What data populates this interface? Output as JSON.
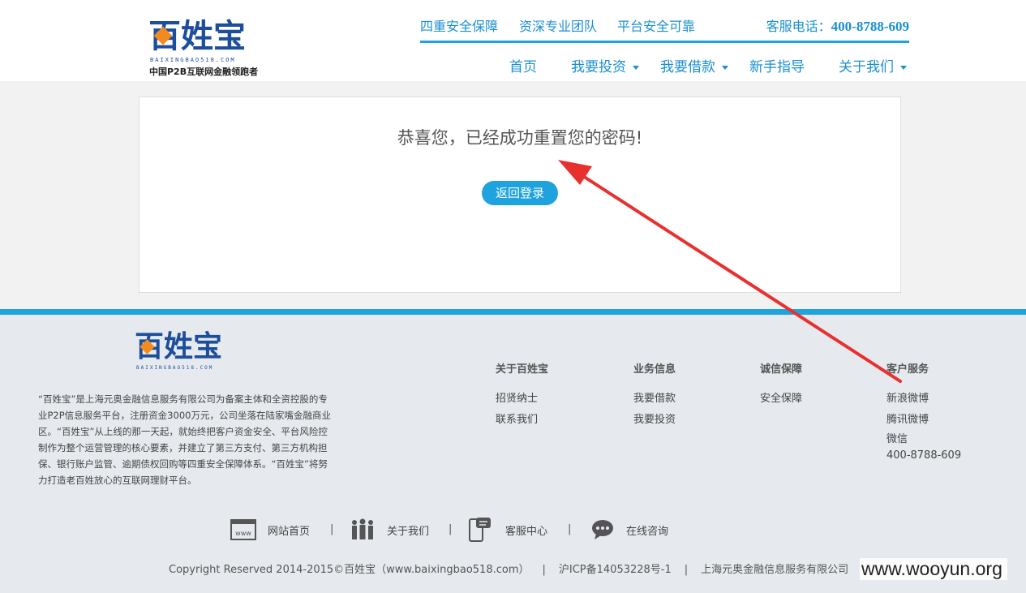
{
  "header": {
    "logo_text": "百姓宝",
    "logo_domain": "BAIXINGBAO518.COM",
    "logo_slogan": "中国P2B互联网金融领跑者",
    "features": [
      "四重安全保障",
      "资深专业团队",
      "平台安全可靠"
    ],
    "phone_label": "客服电话：",
    "phone_number": "400-8788-609",
    "nav": [
      {
        "label": "首页",
        "has_dropdown": false
      },
      {
        "label": "我要投资",
        "has_dropdown": true
      },
      {
        "label": "我要借款",
        "has_dropdown": true
      },
      {
        "label": "新手指导",
        "has_dropdown": false
      },
      {
        "label": "关于我们",
        "has_dropdown": true
      }
    ]
  },
  "main": {
    "success_message": "恭喜您，已经成功重置您的密码!",
    "back_button": "返回登录"
  },
  "footer": {
    "logo_text": "百姓宝",
    "logo_domain": "BAIXINGBAO518.COM",
    "about": "“百姓宝”是上海元奥金融信息服务有限公司为备案主体和全资控股的专业P2P信息服务平台，注册资金3000万元，公司坐落在陆家嘴金融商业区。“百姓宝”从上线的那一天起，就始终把客户资金安全、平台风险控制作为整个运营管理的核心要素，并建立了第三方支付、第三方机构担保、银行账户监管、逾期债权回购等四重安全保障体系。“百姓宝”将努力打造老百姓放心的互联网理财平台。",
    "columns": [
      {
        "title": "关于百姓宝",
        "items": [
          "招贤纳士",
          "联系我们"
        ]
      },
      {
        "title": "业务信息",
        "items": [
          "我要借款",
          "我要投资"
        ]
      },
      {
        "title": "诚信保障",
        "items": [
          "安全保障"
        ]
      },
      {
        "title": "客户服务",
        "items": [
          "新浪微博",
          "腾讯微博",
          "微信",
          "400-8788-609"
        ]
      }
    ],
    "links": [
      "网站首页",
      "关于我们",
      "客服中心",
      "在线咨询"
    ],
    "separator": "|",
    "copyright": "Copyright Reserved 2014-2015©百姓宝（www.baixingbao518.com）",
    "icp": "沪ICP备14053228号-1",
    "company": "上海元奥金融信息服务有限公司"
  },
  "watermark": "www.wooyun.org",
  "colors": {
    "accent": "#1fa3de",
    "link": "#1b8fd1",
    "logo_blue": "#1d4e9c",
    "logo_orange": "#f28a1f",
    "annotation_red": "#e8302f"
  }
}
